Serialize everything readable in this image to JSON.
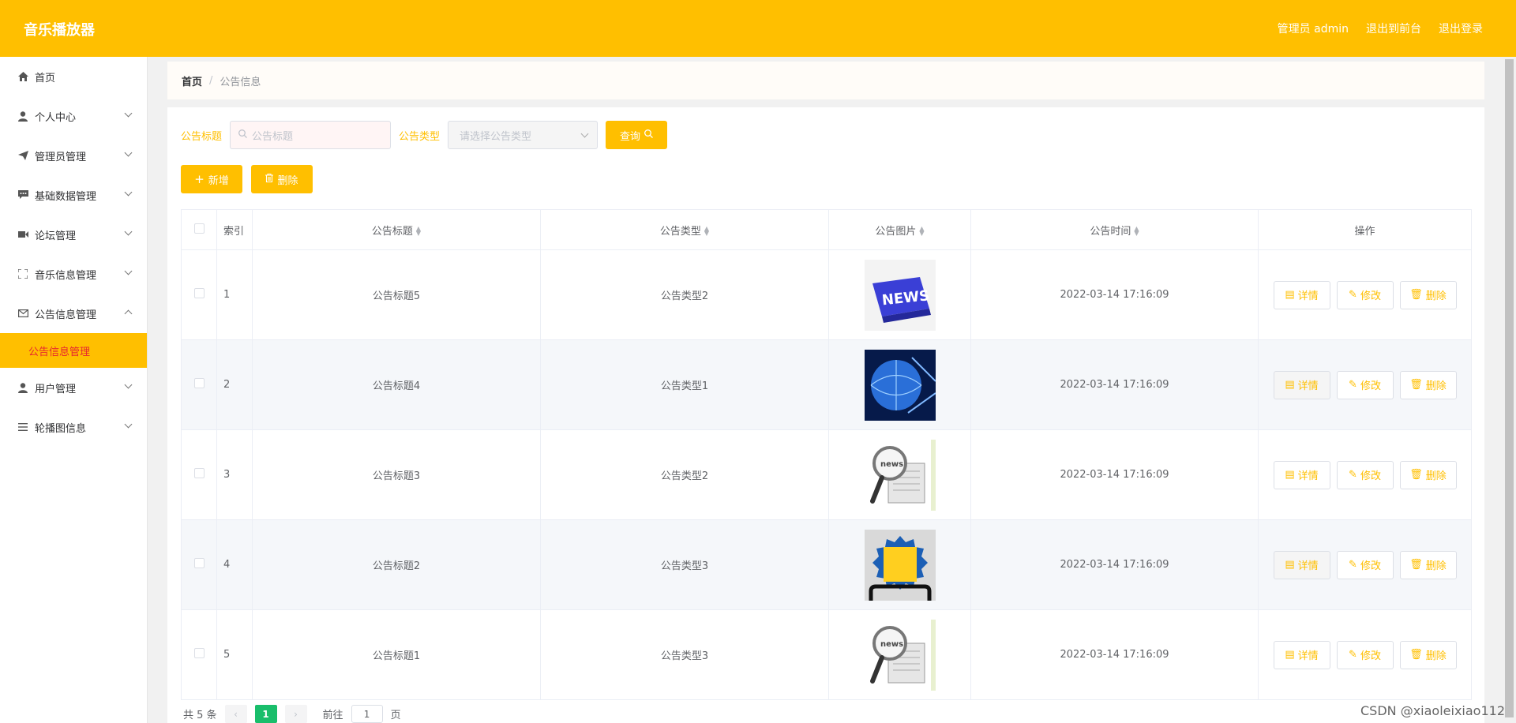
{
  "header": {
    "title": "音乐播放器",
    "admin": "管理员 admin",
    "to_front": "退出到前台",
    "logout": "退出登录"
  },
  "sidebar": {
    "items": [
      {
        "label": "首页",
        "icon": "home-icon"
      },
      {
        "label": "个人中心",
        "icon": "user-icon"
      },
      {
        "label": "管理员管理",
        "icon": "send-icon"
      },
      {
        "label": "基础数据管理",
        "icon": "message-icon"
      },
      {
        "label": "论坛管理",
        "icon": "video-icon"
      },
      {
        "label": "音乐信息管理",
        "icon": "fullscreen-icon"
      },
      {
        "label": "公告信息管理",
        "icon": "message-box-icon"
      },
      {
        "label": "用户管理",
        "icon": "user-icon"
      },
      {
        "label": "轮播图信息",
        "icon": "menu-icon"
      }
    ],
    "active_sub": "公告信息管理"
  },
  "breadcrumb": {
    "home": "首页",
    "sep": "/",
    "current": "公告信息"
  },
  "search": {
    "title_label": "公告标题",
    "title_placeholder": "公告标题",
    "type_label": "公告类型",
    "type_placeholder": "请选择公告类型",
    "query_button": "查询"
  },
  "actions": {
    "add": "新增",
    "delete": "删除"
  },
  "table": {
    "headers": [
      "索引",
      "公告标题",
      "公告类型",
      "公告图片",
      "公告时间",
      "操作"
    ],
    "rows": [
      {
        "index": "1",
        "title": "公告标题5",
        "type": "公告类型2",
        "image": "news-keyboard",
        "time": "2022-03-14 17:16:09"
      },
      {
        "index": "2",
        "title": "公告标题4",
        "type": "公告类型1",
        "image": "globe-blue",
        "time": "2022-03-14 17:16:09"
      },
      {
        "index": "3",
        "title": "公告标题3",
        "type": "公告类型2",
        "image": "magnifier-news",
        "time": "2022-03-14 17:16:09"
      },
      {
        "index": "4",
        "title": "公告标题2",
        "type": "公告类型3",
        "image": "hot-news-badge",
        "time": "2022-03-14 17:16:09"
      },
      {
        "index": "5",
        "title": "公告标题1",
        "type": "公告类型3",
        "image": "magnifier-news",
        "time": "2022-03-14 17:16:09"
      }
    ],
    "op_detail": "详情",
    "op_edit": "修改",
    "op_delete": "删除"
  },
  "pager": {
    "total": "共 5 条",
    "current": "1",
    "goto": "前往",
    "goto_value": "1",
    "page_unit": "页"
  },
  "watermark": "CSDN @xiaoleixiao112",
  "colors": {
    "accent": "#ffbf00",
    "active_text": "#e7262f",
    "page_active": "#19be6b"
  }
}
